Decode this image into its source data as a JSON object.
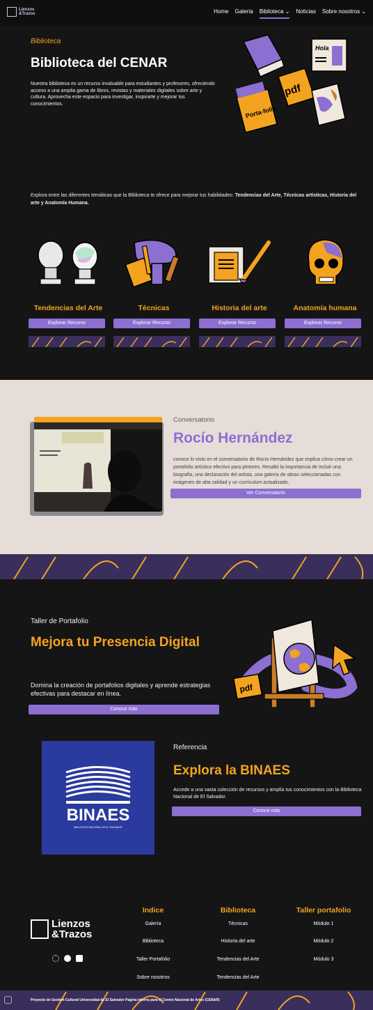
{
  "nav": {
    "logo_line1": "Lienzos",
    "logo_line2": "&Trazos",
    "items": [
      {
        "label": "Home"
      },
      {
        "label": "Galería"
      },
      {
        "label": "Biblioteca ⌄"
      },
      {
        "label": "Noticias"
      },
      {
        "label": "Sobre nosotros ⌄"
      }
    ]
  },
  "hero": {
    "kicker": "Biblioteca",
    "title": "Biblioteca del CENAR",
    "description": "Nuestra biblioteca es un recurso invaluable para estudiantes y profesores, ofreciendo acceso a una amplia gama de libros, revistas y materiales digitales sobre arte y cultura. Aprovecha este espacio para investigar, inspirarte y mejorar tus conocimientos.",
    "art_labels": {
      "hola": "Hola",
      "pdf": "pdf",
      "portafolio": "Porta-folio"
    }
  },
  "intro": {
    "text": "Explora entre las diferentes temáticas que la Biblioteca te ofrece para mejorar tus habilidades: ",
    "bold": "Tendencias del Arte, Técnicas artísticas, Historia del arte y Anatomía Humana."
  },
  "categories": [
    {
      "title": "Tendencias del Arte",
      "button": "Explorar Recurso"
    },
    {
      "title": "Técnicas",
      "button": "Explorar Recurso"
    },
    {
      "title": "Historia del arte",
      "button": "Explorar Recurso"
    },
    {
      "title": "Anatomía humana",
      "button": "Explorar Recurso"
    }
  ],
  "conversatorio": {
    "kicker": "Conversatorio",
    "title": "Rocío Hernández",
    "description": "conoce lo visto en el conversatorio de Rocío Hernández que explica cómo crear un portafolio artístico efectivo para pintores. Resaltó la importancia de incluir una biografía, una declaración del artista, una galería de obras seleccionadas con imágenes de alta calidad y un currículum actualizado.",
    "button": "Ver Conversatorio"
  },
  "taller": {
    "kicker": "Taller de Portafolio",
    "title": "Mejora tu Presencia Digital",
    "description": "Domina la creación de portafolios digitales y aprende estrategias efectivas para destacar en línea.",
    "button": "Conoce más",
    "art_pdf": "pdf"
  },
  "referencia": {
    "kicker": "Referencia",
    "title": "Explora la BINAES",
    "description": "Accede a una vasta colección de recursos y amplía tus conocimientos con la Biblioteca Nacional de El Salvador.",
    "button": "Conoce más",
    "logo_name": "BINAES",
    "logo_sub": "BIBLIOTECA NACIONAL DE EL SALVADOR"
  },
  "footer": {
    "logo_line1": "Lienzos",
    "logo_line2": "&Trazos",
    "columns": [
      {
        "title": "Indice",
        "links": [
          "Galería",
          "Biblioteca",
          "Taller Portafolio",
          "Sobre nosotros"
        ]
      },
      {
        "title": "Biblioteca",
        "links": [
          "Técnicas",
          "Historia del arte",
          "Tendencias del Arte",
          "Tendencias del Arte"
        ]
      },
      {
        "title": "Taller portafolio",
        "links": [
          "Módulo 1",
          "Módulo 2",
          "Módulo 3"
        ]
      }
    ],
    "bottom_text": "Proyecto de Gestion Cultural Universidad de El Salvador Pagina interna para el Centro Nacional de Artes (CENAR)"
  },
  "colors": {
    "accent": "#f3a320",
    "purple": "#8c6fd1",
    "dark": "#151516",
    "beige": "#e6ddd8"
  }
}
